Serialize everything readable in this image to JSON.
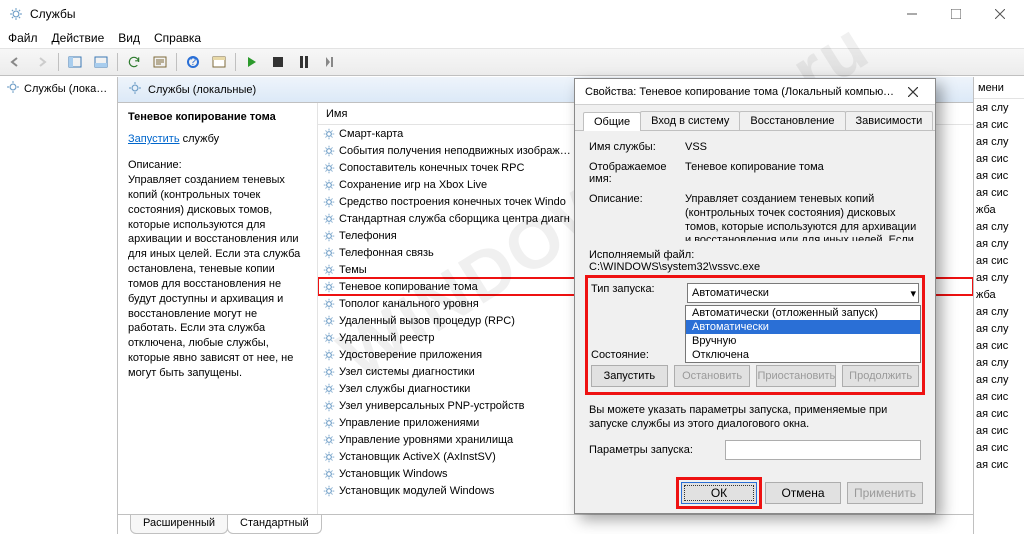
{
  "window": {
    "title": "Службы",
    "min_tooltip": "Свернуть",
    "max_tooltip": "Развернуть",
    "close_tooltip": "Закрыть"
  },
  "menu": {
    "file": "Файл",
    "action": "Действие",
    "view": "Вид",
    "help": "Справка"
  },
  "tree": {
    "root": "Службы (локальн"
  },
  "mid_header": "Службы (локальные)",
  "detail": {
    "selected_service": "Теневое копирование тома",
    "start_link": "Запустить",
    "start_suffix": " службу",
    "desc_label": "Описание:",
    "desc": "Управляет созданием теневых копий (контрольных точек состояния) дисковых томов, которые используются для архивации и восстановления или для иных целей. Если эта служба остановлена, теневые копии томов для восстановления не будут доступны и архивация и восстановление могут не работать. Если эта служба отключена, любые службы, которые явно зависят от нее, не могут быть запущены."
  },
  "list_header": "Имя",
  "services": [
    "Смарт-карта",
    "События получения неподвижных изображ…",
    "Сопоставитель конечных точек RPC",
    "Сохранение игр на Xbox Live",
    "Средство построения конечных точек Windo",
    "Стандартная служба сборщика центра диагн",
    "Телефония",
    "Телефонная связь",
    "Темы",
    "Теневое копирование тома",
    "Тополог канального уровня",
    "Удаленный вызов процедур (RPC)",
    "Удаленный реестр",
    "Удостоверение приложения",
    "Узел системы диагностики",
    "Узел службы диагностики",
    "Узел универсальных PNP-устройств",
    "Управление приложениями",
    "Управление уровнями хранилища",
    "Установщик ActiveX (AxInstSV)",
    "Установщик Windows",
    "Установщик модулей Windows"
  ],
  "highlight_index": 9,
  "bottom_tabs": {
    "extended": "Расширенный",
    "standard": "Стандартный"
  },
  "right_ghost": {
    "hdr": "мени",
    "rows": [
      "ая слу",
      "ая сис",
      "ая слу",
      "ая сис",
      "ая сис",
      "ая сис",
      "жба",
      "ая слу",
      "ая слу",
      "ая сис",
      "ая слу",
      "жба",
      "ая слу",
      "ая слу",
      "ая сис",
      "ая слу",
      "ая слу",
      "ая сис",
      "ая сис",
      "ая сис",
      "ая сис",
      "ая сис"
    ]
  },
  "dialog": {
    "title": "Свойства: Теневое копирование тома (Локальный компьютер)",
    "tabs": [
      "Общие",
      "Вход в систему",
      "Восстановление",
      "Зависимости"
    ],
    "lbl_name": "Имя службы:",
    "val_name": "VSS",
    "lbl_disp": "Отображаемое имя:",
    "val_disp": "Теневое копирование тома",
    "lbl_desc": "Описание:",
    "val_desc": "Управляет созданием теневых копий (контрольных точек состояния) дисковых томов, которые используются для архивации и восстановления или для иных целей. Если эта",
    "lbl_exe": "Исполняемый файл:",
    "val_exe": "C:\\WINDOWS\\system32\\vssvc.exe",
    "lbl_startup": "Тип запуска:",
    "startup_value": "Автоматически",
    "startup_options": [
      "Автоматически (отложенный запуск)",
      "Автоматически",
      "Вручную",
      "Отключена"
    ],
    "lbl_state": "Состояние:",
    "btn_start": "Запустить",
    "btn_stop": "Остановить",
    "btn_pause": "Приостановить",
    "btn_resume": "Продолжить",
    "hint": "Вы можете указать параметры запуска, применяемые при запуске службы из этого диалогового окна.",
    "lbl_params": "Параметры запуска:",
    "ok": "ОК",
    "cancel": "Отмена",
    "apply": "Применить"
  },
  "watermark": "WINDOWS 10x.ru"
}
